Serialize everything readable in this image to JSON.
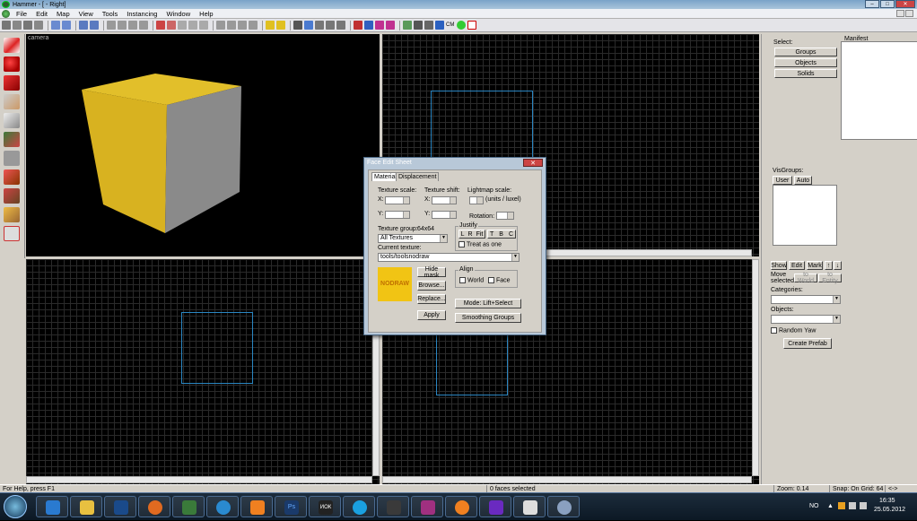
{
  "window": {
    "title": "Hammer - [ - Right]",
    "min": "–",
    "max": "□",
    "close": "✕"
  },
  "menu": [
    "File",
    "Edit",
    "Map",
    "View",
    "Tools",
    "Instancing",
    "Window",
    "Help"
  ],
  "toolbar": {
    "cm_label": "CM"
  },
  "views": {
    "camera_label": "camera"
  },
  "panel": {
    "select_label": "Select:",
    "manifest_label": "Manifest",
    "groups": "Groups",
    "objects": "Objects",
    "solids": "Solids",
    "visgroups_label": "VisGroups:",
    "tab_user": "User",
    "tab_auto": "Auto",
    "show": "Show",
    "edit": "Edit",
    "mark": "Mark",
    "up": "↑",
    "down": "↓",
    "move_selected": "Move selected:",
    "to_world": "to World",
    "to_entity": "to Entity",
    "categories": "Categories:",
    "objects_label": "Objects:",
    "random_yaw": "Random Yaw",
    "create_prefab": "Create Prefab"
  },
  "dialog": {
    "title": "Face Edit Sheet",
    "close": "✕",
    "tab_material": "Material",
    "tab_displacement": "Displacement",
    "texture_scale": "Texture scale:",
    "texture_shift": "Texture shift:",
    "lightmap_scale": "Lightmap scale:",
    "units_luxel": "(units / luxel)",
    "x": "X:",
    "y": "Y:",
    "rotation": "Rotation:",
    "justify": "Justify",
    "justify_buttons": [
      "L",
      "R",
      "Fit",
      "T",
      "B",
      "C"
    ],
    "treat_as_one": "Treat as one",
    "texture_group": "Texture group:",
    "texture_size": "64x64",
    "texture_group_value": "All Textures",
    "current_texture": "Current texture:",
    "current_texture_value": "tools/toolsnodraw",
    "nodraw": "NODRAW",
    "hide_mask": "Hide mask",
    "browse": "Browse...",
    "replace": "Replace...",
    "apply": "Apply",
    "align": "Align",
    "world": "World",
    "face": "Face",
    "mode": "Mode: Lift+Select",
    "smoothing_groups": "Smoothing Groups"
  },
  "status": {
    "help": "For Help, press F1",
    "faces": "0 faces selected",
    "zoom": "Zoom: 0.14",
    "snap": "Snap: On Grid: 64",
    "arrows": "<->"
  },
  "tray": {
    "lang": "NO",
    "time": "16:35",
    "date": "25.05.2012"
  },
  "taskbar": {
    "uok_label": "ИОК"
  }
}
